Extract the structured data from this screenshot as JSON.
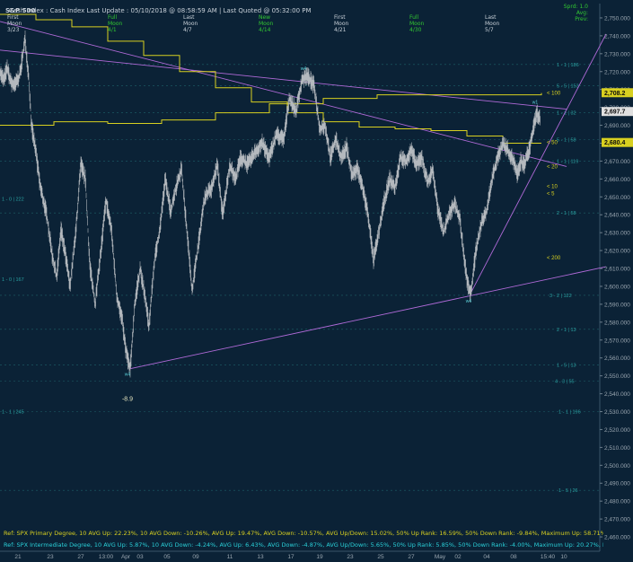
{
  "header": {
    "symbol": "S&P 500",
    "title_text": "Cash Index : Cash Index   Last Update : 05/10/2018 @ 08:58:59 AM | Last Quoted @ 05:32:00 PM",
    "moon_phases": [
      {
        "phase": "First",
        "label": "Moon",
        "date": "3/23",
        "green": false
      },
      {
        "phase": "Full",
        "label": "Moon",
        "date": "4/1",
        "green": true
      },
      {
        "phase": "Last",
        "label": "Moon",
        "date": "4/7",
        "green": false
      },
      {
        "phase": "New",
        "label": "Moon",
        "date": "4/14",
        "green": true
      },
      {
        "phase": "First",
        "label": "Moon",
        "date": "4/21",
        "green": false
      },
      {
        "phase": "Full",
        "label": "Moon",
        "date": "4/30",
        "green": true
      },
      {
        "phase": "Last",
        "label": "Moon",
        "date": "5/7",
        "green": false
      }
    ],
    "spread": "Sprd: 1.0",
    "avg_label": "Avg:",
    "prev_label": "Prev:"
  },
  "chart_data": {
    "type": "line",
    "instrument": "S&P 500 Cash Index",
    "ylim": [
      2452,
      2758
    ],
    "y_ticks": [
      2460,
      2470,
      2480,
      2490,
      2500,
      2510,
      2520,
      2530,
      2540,
      2550,
      2560,
      2570,
      2580,
      2590,
      2600,
      2610,
      2620,
      2630,
      2640,
      2650,
      2660,
      2670,
      2680,
      2690,
      2700,
      2710,
      2720,
      2730,
      2740,
      2750
    ],
    "x_tick_labels": [
      "21",
      "23",
      "27",
      "13:00",
      "Apr",
      "03",
      "05",
      "09",
      "11",
      "13",
      "17",
      "19",
      "23",
      "25",
      "27",
      "May",
      "02",
      "04",
      "08",
      "15:40",
      "10"
    ],
    "price_anchors": [
      {
        "t": 0,
        "v": 2720
      },
      {
        "t": 4,
        "v": 2715
      },
      {
        "t": 8,
        "v": 2722
      },
      {
        "t": 12,
        "v": 2714
      },
      {
        "t": 16,
        "v": 2712
      },
      {
        "t": 22,
        "v": 2718
      },
      {
        "t": 28,
        "v": 2738
      },
      {
        "t": 32,
        "v": 2717
      },
      {
        "t": 35,
        "v": 2690
      },
      {
        "t": 40,
        "v": 2675
      },
      {
        "t": 45,
        "v": 2655
      },
      {
        "t": 52,
        "v": 2640
      },
      {
        "t": 58,
        "v": 2618
      },
      {
        "t": 63,
        "v": 2605
      },
      {
        "t": 68,
        "v": 2632
      },
      {
        "t": 73,
        "v": 2617
      },
      {
        "t": 78,
        "v": 2600
      },
      {
        "t": 84,
        "v": 2628
      },
      {
        "t": 90,
        "v": 2668
      },
      {
        "t": 95,
        "v": 2660
      },
      {
        "t": 100,
        "v": 2612
      },
      {
        "t": 106,
        "v": 2590
      },
      {
        "t": 112,
        "v": 2618
      },
      {
        "t": 118,
        "v": 2648
      },
      {
        "t": 124,
        "v": 2632
      },
      {
        "t": 130,
        "v": 2595
      },
      {
        "t": 136,
        "v": 2581
      },
      {
        "t": 140,
        "v": 2565
      },
      {
        "t": 145,
        "v": 2553
      },
      {
        "t": 150,
        "v": 2590
      },
      {
        "t": 156,
        "v": 2610
      },
      {
        "t": 162,
        "v": 2592
      },
      {
        "t": 166,
        "v": 2578
      },
      {
        "t": 172,
        "v": 2614
      },
      {
        "t": 178,
        "v": 2632
      },
      {
        "t": 184,
        "v": 2660
      },
      {
        "t": 190,
        "v": 2642
      },
      {
        "t": 196,
        "v": 2655
      },
      {
        "t": 202,
        "v": 2666
      },
      {
        "t": 208,
        "v": 2632
      },
      {
        "t": 214,
        "v": 2598
      },
      {
        "t": 220,
        "v": 2620
      },
      {
        "t": 228,
        "v": 2650
      },
      {
        "t": 236,
        "v": 2655
      },
      {
        "t": 242,
        "v": 2668
      },
      {
        "t": 248,
        "v": 2640
      },
      {
        "t": 256,
        "v": 2668
      },
      {
        "t": 262,
        "v": 2660
      },
      {
        "t": 268,
        "v": 2672
      },
      {
        "t": 276,
        "v": 2668
      },
      {
        "t": 284,
        "v": 2675
      },
      {
        "t": 292,
        "v": 2680
      },
      {
        "t": 300,
        "v": 2672
      },
      {
        "t": 308,
        "v": 2685
      },
      {
        "t": 316,
        "v": 2682
      },
      {
        "t": 322,
        "v": 2705
      },
      {
        "t": 330,
        "v": 2698
      },
      {
        "t": 336,
        "v": 2715
      },
      {
        "t": 342,
        "v": 2718
      },
      {
        "t": 350,
        "v": 2712
      },
      {
        "t": 356,
        "v": 2688
      },
      {
        "t": 362,
        "v": 2690
      },
      {
        "t": 368,
        "v": 2672
      },
      {
        "t": 374,
        "v": 2682
      },
      {
        "t": 380,
        "v": 2672
      },
      {
        "t": 386,
        "v": 2678
      },
      {
        "t": 392,
        "v": 2662
      },
      {
        "t": 398,
        "v": 2666
      },
      {
        "t": 404,
        "v": 2655
      },
      {
        "t": 410,
        "v": 2640
      },
      {
        "t": 416,
        "v": 2615
      },
      {
        "t": 422,
        "v": 2630
      },
      {
        "t": 428,
        "v": 2648
      },
      {
        "t": 434,
        "v": 2660
      },
      {
        "t": 440,
        "v": 2655
      },
      {
        "t": 446,
        "v": 2672
      },
      {
        "t": 452,
        "v": 2670
      },
      {
        "t": 458,
        "v": 2676
      },
      {
        "t": 464,
        "v": 2668
      },
      {
        "t": 470,
        "v": 2672
      },
      {
        "t": 476,
        "v": 2658
      },
      {
        "t": 482,
        "v": 2665
      },
      {
        "t": 488,
        "v": 2642
      },
      {
        "t": 494,
        "v": 2630
      },
      {
        "t": 500,
        "v": 2640
      },
      {
        "t": 506,
        "v": 2646
      },
      {
        "t": 512,
        "v": 2638
      },
      {
        "t": 516,
        "v": 2620
      },
      {
        "t": 520,
        "v": 2604
      },
      {
        "t": 524,
        "v": 2595
      },
      {
        "t": 530,
        "v": 2620
      },
      {
        "t": 536,
        "v": 2635
      },
      {
        "t": 542,
        "v": 2642
      },
      {
        "t": 548,
        "v": 2660
      },
      {
        "t": 554,
        "v": 2672
      },
      {
        "t": 560,
        "v": 2680
      },
      {
        "t": 566,
        "v": 2676
      },
      {
        "t": 572,
        "v": 2670
      },
      {
        "t": 576,
        "v": 2662
      },
      {
        "t": 580,
        "v": 2670
      },
      {
        "t": 584,
        "v": 2668
      },
      {
        "t": 590,
        "v": 2678
      },
      {
        "t": 594,
        "v": 2688
      },
      {
        "t": 598,
        "v": 2697
      },
      {
        "t": 602,
        "v": 2693
      }
    ],
    "moving_averages": [
      {
        "name": "100",
        "label": "< 100",
        "value": 2708.2,
        "color": "#d8d020",
        "points": [
          [
            0,
            2690
          ],
          [
            60,
            2692
          ],
          [
            120,
            2691
          ],
          [
            180,
            2693
          ],
          [
            240,
            2697
          ],
          [
            300,
            2702
          ],
          [
            360,
            2705
          ],
          [
            420,
            2707
          ],
          [
            480,
            2707
          ],
          [
            540,
            2707
          ],
          [
            603,
            2708
          ]
        ]
      },
      {
        "name": "50",
        "label": "< 50",
        "value": 2680.4,
        "color": "#d8d020",
        "points": [
          [
            0,
            2752
          ],
          [
            40,
            2749
          ],
          [
            80,
            2745
          ],
          [
            120,
            2737
          ],
          [
            160,
            2729
          ],
          [
            200,
            2720
          ],
          [
            240,
            2711
          ],
          [
            280,
            2703
          ],
          [
            320,
            2697
          ],
          [
            360,
            2692
          ],
          [
            400,
            2689
          ],
          [
            440,
            2688
          ],
          [
            480,
            2687
          ],
          [
            520,
            2684
          ],
          [
            560,
            2680
          ],
          [
            603,
            2680
          ]
        ]
      }
    ],
    "ma_tags": [
      {
        "label": "< 20",
        "value": 2667
      },
      {
        "label": "< 10",
        "value": 2656
      },
      {
        "label": "< 5",
        "value": 2652
      },
      {
        "label": "< 200",
        "value": 2616
      }
    ],
    "price_tags": [
      {
        "value": 2708.2,
        "text": "2,708.2",
        "color": "#d8d020"
      },
      {
        "value": 2697.7,
        "text": "2,697.7",
        "color": "#e0e0e0"
      },
      {
        "value": 2680.4,
        "text": "2,680.4",
        "color": "#d8d020"
      }
    ],
    "trendlines": [
      {
        "from": [
          0,
          2732
        ],
        "to": [
          631,
          2699
        ],
        "color": "#b06ad8"
      },
      {
        "from": [
          0,
          2748
        ],
        "to": [
          631,
          2667
        ],
        "color": "#b06ad8"
      },
      {
        "from": [
          145,
          2554
        ],
        "to": [
          675,
          2611
        ],
        "color": "#b06ad8"
      },
      {
        "from": [
          524,
          2596
        ],
        "to": [
          675,
          2741
        ],
        "color": "#b06ad8"
      }
    ],
    "annotations": [
      {
        "text": "-8.9",
        "t": 142,
        "v": 2536,
        "color": "#e6e6c0"
      },
      {
        "text": "w4",
        "t": 142,
        "v": 2550,
        "color": "#5ad0d8"
      },
      {
        "text": "w4",
        "t": 338,
        "v": 2721,
        "color": "#5ad0d8"
      },
      {
        "text": "w4",
        "t": 522,
        "v": 2591,
        "color": "#5ad0d8"
      },
      {
        "text": "w1",
        "t": 596,
        "v": 2702,
        "color": "#5ad0d8"
      }
    ],
    "fib_labels": [
      {
        "text": "1 - 1 | 186",
        "t": 620,
        "v": 2724
      },
      {
        "text": "5 - 5 | 153",
        "t": 620,
        "v": 2712
      },
      {
        "text": "1 - 1 | 32",
        "t": 620,
        "v": 2697
      },
      {
        "text": "5 - 1 | 58",
        "t": 620,
        "v": 2682
      },
      {
        "text": "1 - 1 | 119",
        "t": 620,
        "v": 2670
      },
      {
        "text": "2 - 1 | 58",
        "t": 620,
        "v": 2641
      },
      {
        "text": "3 - 2 | 122",
        "t": 612,
        "v": 2595
      },
      {
        "text": "2 - 1 | 13",
        "t": 620,
        "v": 2576
      },
      {
        "text": "1 - 5 | 13",
        "t": 620,
        "v": 2556
      },
      {
        "text": "4 - 3 | 55",
        "t": 618,
        "v": 2547
      },
      {
        "text": "1 - 1 | 196",
        "t": 622,
        "v": 2530
      },
      {
        "text": "1 - 5 | 26",
        "t": 622,
        "v": 2486
      },
      {
        "text": "1 - 0 | 222",
        "t": 2,
        "v": 2649
      },
      {
        "text": "1 - 0 | 167",
        "t": 2,
        "v": 2604
      },
      {
        "text": "1 - 1 | 245",
        "t": 2,
        "v": 2530
      }
    ],
    "fib_level_values": [
      2724,
      2712,
      2697,
      2682,
      2670,
      2641,
      2595,
      2576,
      2556,
      2547,
      2530,
      2486
    ]
  },
  "footer": {
    "line1": "Ref: SPX Primary Degree, 10 AVG Up: 22.23%, 10 AVG Down: -10.26%, AVG Up: 19.47%, AVG Down: -10.57%, AVG Up/Down: 15.02%, 50%  Up Rank: 16.59%, 50% Down Rank: -9.84%, Maximum Up: 58.71%, Maximum",
    "line2": "Ref: SPX Intermediate Degree, 10 AVG Up: 5.87%, 10 AVG Down: -4.24%, AVG Up: 6.43%, AVG Down: -4.87%, AVG Up/Down: 5.65%, 50%  Up Rank: 5.85%, 50% Down Rank: -4.00%, Maximum Up: 20.27%, Maximum Dc"
  },
  "colors": {
    "background": "#0b2236",
    "price": "#b4b9be",
    "axis_text": "#9aa6b0",
    "ma": "#d8d020",
    "trendline": "#b06ad8",
    "fib": "#2a8a8a"
  }
}
